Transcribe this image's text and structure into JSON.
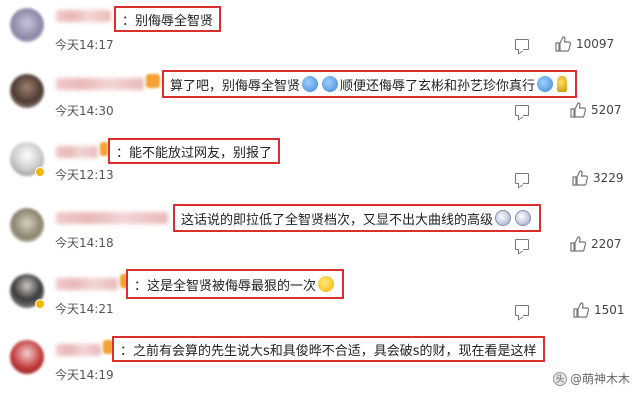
{
  "comments": [
    {
      "text": "：别侮辱全智贤",
      "time": "今天14:17",
      "likes": "10097"
    },
    {
      "text_a": "算了吧，别侮辱全智贤",
      "text_b": "顺便还侮辱了玄彬和孙艺珍你真行",
      "time": "今天14:30",
      "likes": "5207"
    },
    {
      "text": "：能不能放过网友，别报了",
      "time": "今天12:13",
      "likes": "3229"
    },
    {
      "text": "这话说的即拉低了全智贤档次，又显不出大曲线的高级",
      "time": "今天14:18",
      "likes": "2207"
    },
    {
      "text": "：这是全智贤被侮辱最狠的一次",
      "time": "今天14:21",
      "likes": "1501"
    },
    {
      "text": "：之前有会算的先生说大s和具俊晔不合适，具会破s的财，现在看是这样",
      "time": "今天14:19",
      "likes": ""
    }
  ],
  "watermark": {
    "logo": "头",
    "text": "@萌神木木"
  }
}
